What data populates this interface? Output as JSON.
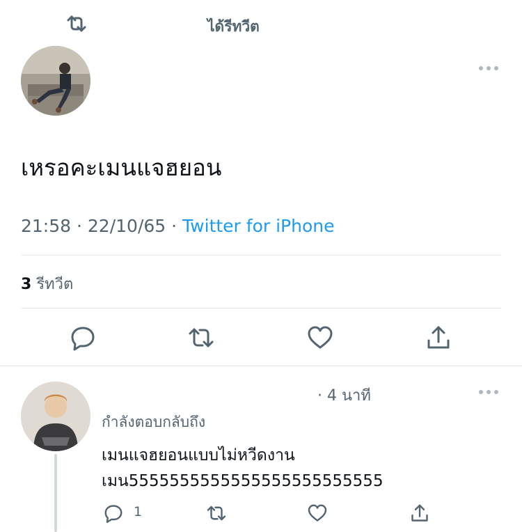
{
  "retweet_header": {
    "text": "ได้รีทวีต",
    "icon": "retweet-icon"
  },
  "main_tweet": {
    "text": "เหรอคะเมนแจฮยอน",
    "time": "21:58",
    "date": "22/10/65",
    "separator": "·",
    "source": "Twitter for iPhone",
    "retweet_count": "3",
    "retweet_label": "รีทวีต",
    "actions": [
      "reply-icon",
      "retweet-icon",
      "like-icon",
      "share-icon"
    ]
  },
  "reply": {
    "time": "· 4 นาที",
    "replying_to_label": "กำลังตอบกลับถึง",
    "lines": [
      "เมนแจฮยอนแบบไม่หวีดงาน",
      "เมน5555555555555555555555555"
    ],
    "reply_count": "1",
    "actions": [
      "reply-icon",
      "retweet-icon",
      "like-icon",
      "share-icon"
    ]
  },
  "colors": {
    "text": "#0f1419",
    "secondary": "#536471",
    "link": "#1d9bf0",
    "divider": "#e6e8ea"
  }
}
